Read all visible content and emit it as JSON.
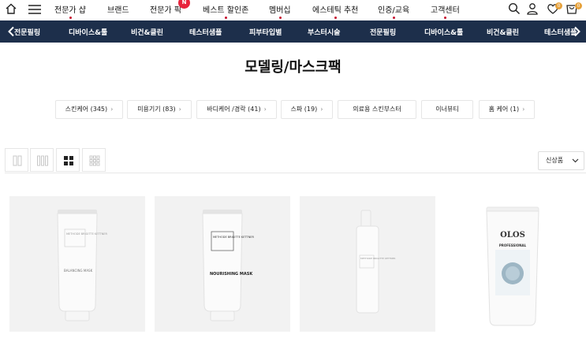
{
  "top_nav": {
    "menu": [
      "전문가 샵",
      "브랜드",
      "전문가 픽",
      "베스트 할인존",
      "멤버십",
      "에스테틱 추천",
      "인증/교육",
      "고객센터"
    ],
    "new_badge": "N",
    "wishlist_count": "0",
    "cart_count": "0"
  },
  "category_bar": {
    "items": [
      "전문필링",
      "디바이스&툴",
      "비건&클린",
      "테스터샘플",
      "피부타입별",
      "부스터시술",
      "전문필링",
      "디바이스&툴",
      "비건&클린",
      "테스터샘플"
    ]
  },
  "page": {
    "title": "모델링/마스크팩"
  },
  "filters": [
    {
      "label": "스킨케어 (345)"
    },
    {
      "label": "미용기기 (83)"
    },
    {
      "label": "바디케어 /경락 (41)"
    },
    {
      "label": "스파 (19)"
    },
    {
      "label": "의료용 스킨부스터"
    },
    {
      "label": "이너뷰티"
    },
    {
      "label": "홈 케어 (1)"
    }
  ],
  "sort": {
    "selected": "신상품"
  },
  "products": [
    {
      "brand": "METHODE BRIGITTE KETTNER",
      "name": "BALANCING MASK"
    },
    {
      "brand": "METHODE BRIGITTE KETTNER",
      "name": "NOURISHING MASK"
    },
    {
      "brand": "METHODE BRIGITTE KETTNER",
      "name": ""
    },
    {
      "brand": "OLOS",
      "name": "PROFESSIONAL"
    }
  ],
  "colors": {
    "navy": "#1d2f4b",
    "accent": "#c8102e",
    "badge": "#e8233c",
    "count": "#e6a23c"
  }
}
